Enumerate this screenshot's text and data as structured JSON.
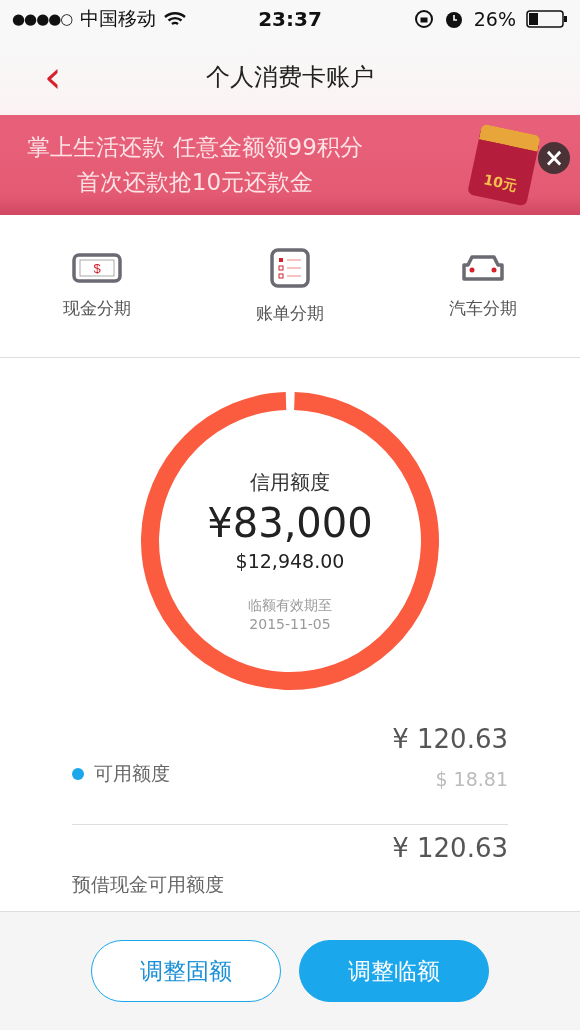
{
  "status_bar": {
    "signal": "●●●●○",
    "carrier": "中国移动",
    "time": "23:37",
    "battery": "26%"
  },
  "nav": {
    "back": "‹",
    "title": "个人消费卡账户"
  },
  "banner": {
    "lines": [
      "掌上生活还款 任意金额领99积分",
      "首次还款抢10元还款金"
    ],
    "envelope": "10元",
    "close": "×"
  },
  "shortcuts": [
    {
      "kind": "cash",
      "label": "现金分期",
      "icon_text": "$"
    },
    {
      "kind": "bill",
      "label": "账单分期"
    },
    {
      "kind": "car",
      "label": "汽车分期"
    }
  ],
  "credit": {
    "title": "信用额度",
    "amount": "¥83,000",
    "usd": "$12,948.00",
    "note": "临额有效期至",
    "date": "2015-11-05",
    "level": 0.99
  },
  "balances": [
    {
      "label": "可用额度",
      "color": "#1aa7ec",
      "cny": "¥ 120.63",
      "usd": "$ 18.81"
    },
    {
      "label": "预借现金可用额度",
      "cny": "¥ 120.63"
    }
  ],
  "buttons": [
    {
      "label": "调整固额",
      "kind": "outline"
    },
    {
      "label": "调整临额",
      "kind": "filled"
    }
  ]
}
